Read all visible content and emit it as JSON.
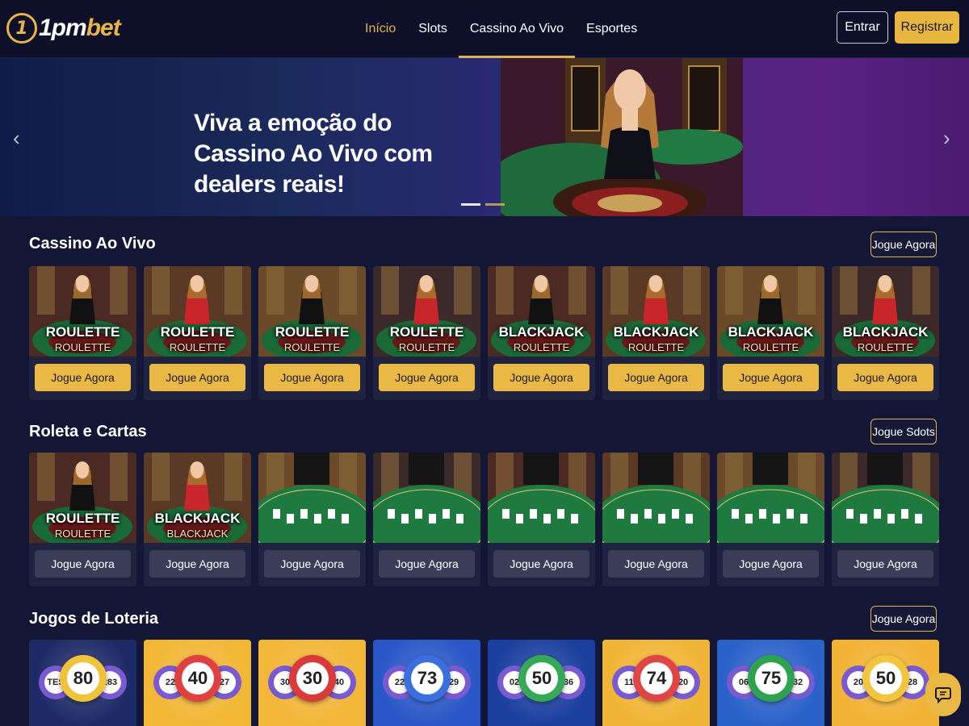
{
  "brand": {
    "logo_mark": "1",
    "name_prefix": "1pm",
    "name_suffix": "bet"
  },
  "nav": {
    "items": [
      {
        "label": "Início"
      },
      {
        "label": "Slots"
      },
      {
        "label": "Cassino Ao Vivo"
      },
      {
        "label": "Esportes"
      }
    ],
    "login_label": "Entrar",
    "register_label": "Registrar"
  },
  "hero": {
    "title": "Viva a emoção do Cassino Ao Vivo com dealers reais!",
    "prev_icon": "‹",
    "next_icon": "›"
  },
  "live_casino": {
    "title": "Cassino Ao Vivo",
    "action_label": "Jogue Agora",
    "cards": [
      {
        "title": "ROULETTE",
        "subtitle": "ROULETTE",
        "button": "Jogue Agora"
      },
      {
        "title": "ROULETTE",
        "subtitle": "ROULETTE",
        "button": "Jogue Agora"
      },
      {
        "title": "ROULETTE",
        "subtitle": "ROULETTE",
        "button": "Jogue Agora"
      },
      {
        "title": "ROULETTE",
        "subtitle": "ROULETTE",
        "button": "Jogue Agora"
      },
      {
        "title": "BLACKJACK",
        "subtitle": "ROULETTE",
        "button": "Jogue Agora"
      },
      {
        "title": "BLACKJACK",
        "subtitle": "ROULETTE",
        "button": "Jogue Agora"
      },
      {
        "title": "BLACKJACK",
        "subtitle": "ROULETTE",
        "button": "Jogue Agora"
      },
      {
        "title": "BLACKJACK",
        "subtitle": "ROULETTE",
        "button": "Jogue Agora"
      }
    ]
  },
  "roulette_cards": {
    "title": "Roleta e Cartas",
    "action_label": "Jogue Sdots",
    "cards": [
      {
        "title": "ROULETTE",
        "subtitle": "ROULETTE",
        "button": "Jogue Agora"
      },
      {
        "title": "BLACKJACK",
        "subtitle": "BLACKJACK",
        "button": "Jogue Agora"
      },
      {
        "title": "",
        "subtitle": "",
        "button": "Jogue Agora"
      },
      {
        "title": "",
        "subtitle": "",
        "button": "Jogue Agora"
      },
      {
        "title": "",
        "subtitle": "",
        "button": "Jogue Agora"
      },
      {
        "title": "",
        "subtitle": "",
        "button": "Jogue Agora"
      },
      {
        "title": "",
        "subtitle": "",
        "button": "Jogue Agora"
      },
      {
        "title": "",
        "subtitle": "",
        "button": "Jogue Agora"
      }
    ]
  },
  "lottery": {
    "title": "Jogos de Loteria",
    "action_label": "Jogue Agora",
    "tiles": [
      {
        "main": "80",
        "left": "TES",
        "right": "283",
        "bg": "#1d2a66",
        "ball": "#f0c43a"
      },
      {
        "main": "40",
        "left": "22",
        "right": "27",
        "bg": "#f1b735",
        "ball": "#e04040"
      },
      {
        "main": "30",
        "left": "30",
        "right": "40",
        "bg": "#f2b638",
        "ball": "#d93a3a"
      },
      {
        "main": "73",
        "left": "22",
        "right": "29",
        "bg": "#2a57c7",
        "ball": "#3a6fe0"
      },
      {
        "main": "50",
        "left": "02",
        "right": "36",
        "bg": "#1a3f9e",
        "ball": "#35a957"
      },
      {
        "main": "74",
        "left": "11",
        "right": "20",
        "bg": "#f0b536",
        "ball": "#e04545"
      },
      {
        "main": "75",
        "left": "06",
        "right": "32",
        "bg": "#2b62c9",
        "ball": "#2fa24f"
      },
      {
        "main": "50",
        "left": "20",
        "right": "28",
        "bg": "#f2b234",
        "ball": "#f2c53c"
      }
    ]
  },
  "colors": {
    "accent": "#eab845",
    "background": "#131634",
    "header": "#0e1029"
  },
  "icons": {
    "chat": "chat-bubble-icon"
  }
}
